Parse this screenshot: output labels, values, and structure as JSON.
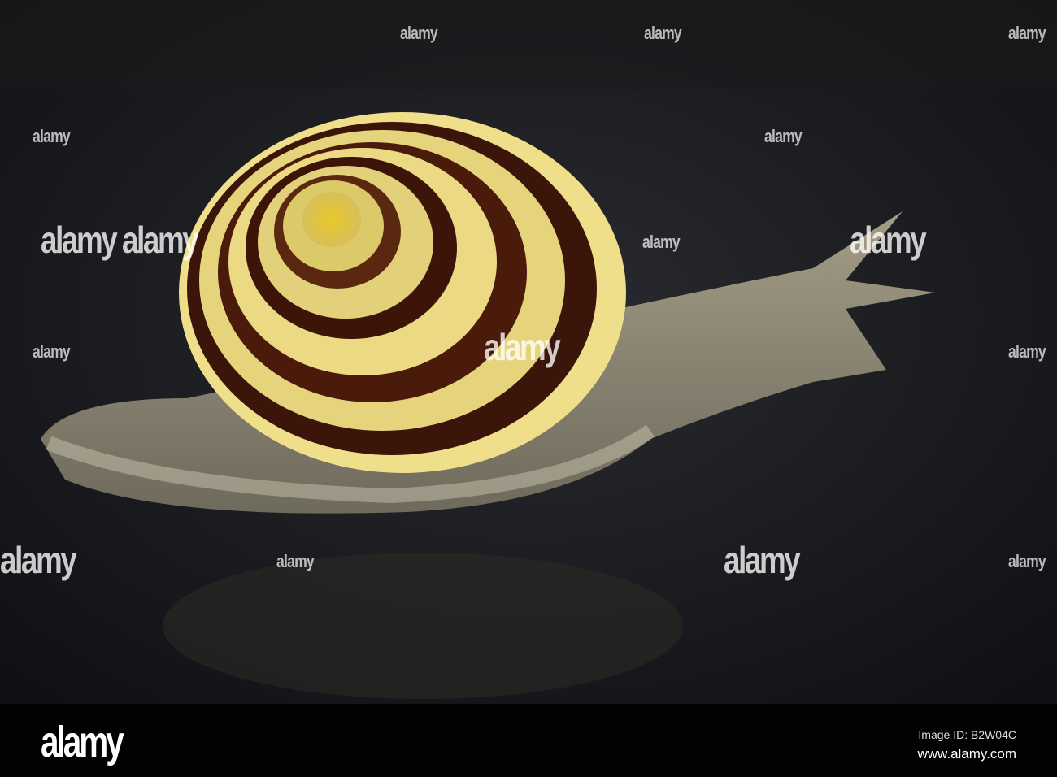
{
  "watermark": {
    "text": "alamy"
  },
  "footer": {
    "logo": "alamy",
    "image_id": "Image ID: B2W04C",
    "url": "www.alamy.com"
  },
  "colors": {
    "shell_yellow": "#e8d36a",
    "shell_brown": "#3a1408",
    "body": "#8d8877",
    "background": "#1c1d22"
  }
}
